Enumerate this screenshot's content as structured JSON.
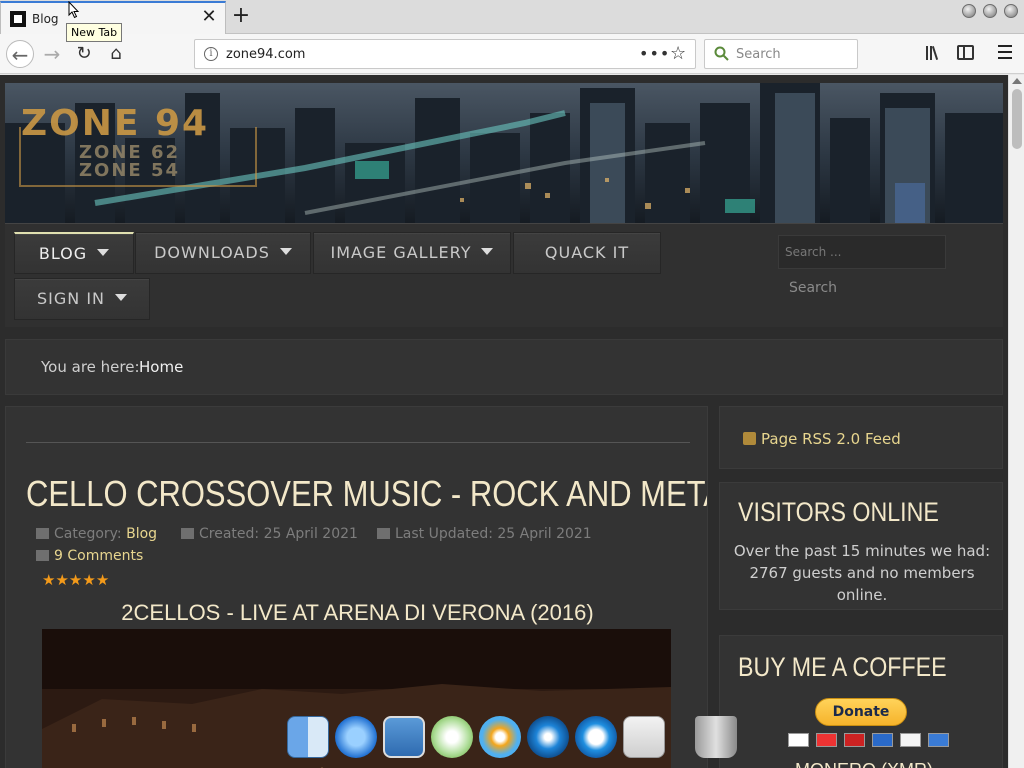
{
  "browser": {
    "tab_title": "Blog",
    "tooltip": "New Tab",
    "url": "zone94.com",
    "search_placeholder": "Search"
  },
  "header": {
    "logo_main": "ZONE 94",
    "logo_sub_1": "ZONE 62",
    "logo_sub_2": "ZONE 54"
  },
  "menu": {
    "items": [
      {
        "label": "BLOG",
        "has_caret": true,
        "active": true
      },
      {
        "label": "DOWNLOADS",
        "has_caret": true,
        "active": false
      },
      {
        "label": "IMAGE GALLERY",
        "has_caret": true,
        "active": false
      },
      {
        "label": "QUACK IT",
        "has_caret": false,
        "active": false
      },
      {
        "label": "SIGN IN",
        "has_caret": true,
        "active": false
      }
    ],
    "search_placeholder": "Search ...",
    "search_button": "Search"
  },
  "breadcrumb": {
    "label": "You are here:",
    "home": "Home"
  },
  "article": {
    "title": "CELLO CROSSOVER MUSIC - ROCK AND METAL",
    "category_label": "Category:",
    "category": "Blog",
    "created": "Created: 25 April 2021",
    "updated": "Last Updated: 25 April 2021",
    "comments": "9 Comments",
    "rating": 5,
    "video_title": "2CELLOS - LIVE AT ARENA DI VERONA (2016)"
  },
  "sidebar": {
    "rss": "Page RSS 2.0 Feed",
    "visitors_title": "VISITORS ONLINE",
    "visitors_text": "Over the past 15 minutes we had: 2767 guests and no members online.",
    "coffee_title": "BUY ME A COFFEE",
    "donate": "Donate",
    "monero": "MONERO (XMR)"
  },
  "colors": {
    "accent": "#e8d68f",
    "title": "#f3e8c9",
    "stars": "#f39a1a",
    "page_bg": "#2c2c2c"
  },
  "dock": {
    "icons": [
      "finder-icon",
      "internet-explorer-icon",
      "preview-icon",
      "itunes-icon",
      "quicktime-player-icon",
      "dvd-player-icon",
      "quicktime-icon",
      "apple-app-icon",
      "trash-icon"
    ]
  }
}
